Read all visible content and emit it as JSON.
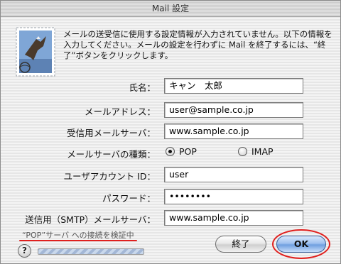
{
  "window": {
    "title": "Mail 設定"
  },
  "app_icon": {
    "name": "mail-stamp-eagle-icon"
  },
  "message": "メールの送受信に使用する設定情報が入力されていません。以下の情報を入力してください。メールの設定を行わずに Mail を終了するには、“終了”ボタンをクリックします。",
  "form": {
    "name": {
      "label": "氏名：",
      "value": "キャン　太郎"
    },
    "email": {
      "label": "メールアドレス：",
      "value": "user@sample.co.jp"
    },
    "incoming_server": {
      "label": "受信用メールサーバ：",
      "value": "www.sample.co.jp"
    },
    "server_type": {
      "label": "メールサーバの種類：",
      "options": [
        "POP",
        "IMAP"
      ],
      "selected": "POP"
    },
    "account_id": {
      "label": "ユーザアカウント ID：",
      "value": "user"
    },
    "password": {
      "label": "パスワード：",
      "value": "••••••••"
    },
    "smtp_server": {
      "label": "送信用（SMTP）メールサーバ：",
      "value": "www.sample.co.jp"
    }
  },
  "status": {
    "text": "“POP”サーバ への接続を検証中"
  },
  "buttons": {
    "help": "?",
    "quit": "終了",
    "ok": "OK"
  },
  "colors": {
    "annotation_red": "#e0201e",
    "default_button_blue": "#6f9fe0"
  }
}
